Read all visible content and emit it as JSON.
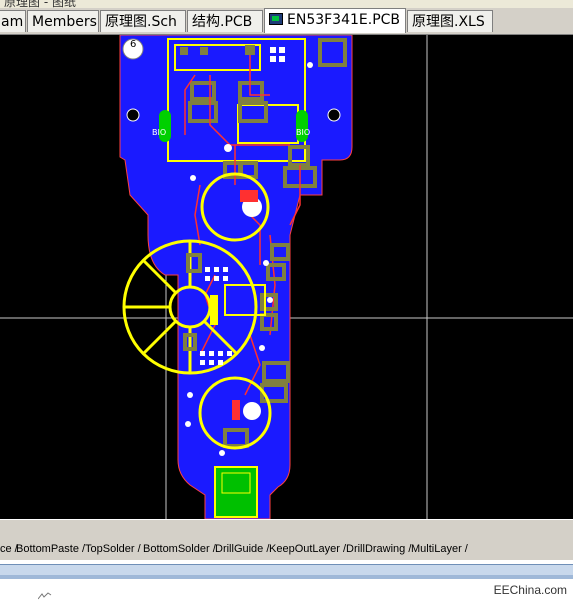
{
  "window": {
    "title_fragment": "原理图 - 图纸"
  },
  "tabs": [
    {
      "label": "am"
    },
    {
      "label": "Members"
    },
    {
      "label": "原理图.Sch"
    },
    {
      "label": "结构.PCB"
    },
    {
      "label": "EN53F341E.PCB",
      "active": true
    },
    {
      "label": "原理图.XLS"
    }
  ],
  "pcb": {
    "labels": {
      "top_marker": "6",
      "left_tag": "BIO",
      "right_tag": "BIO"
    },
    "colors": {
      "board": "#1a1aff",
      "copper_pad": "#808040",
      "silk": "#ffff00",
      "trace": "#ff2020",
      "grid": "#d0d0d0",
      "green_pad": "#00c000"
    }
  },
  "layer_tabs": [
    {
      "label": "ce"
    },
    {
      "label": "BottomPaste"
    },
    {
      "label": "TopSolder"
    },
    {
      "label": "BottomSolder"
    },
    {
      "label": "DrillGuide"
    },
    {
      "label": "KeepOutLayer"
    },
    {
      "label": "DrillDrawing"
    },
    {
      "label": "MultiLayer"
    }
  ],
  "watermark": "EEChina.com"
}
